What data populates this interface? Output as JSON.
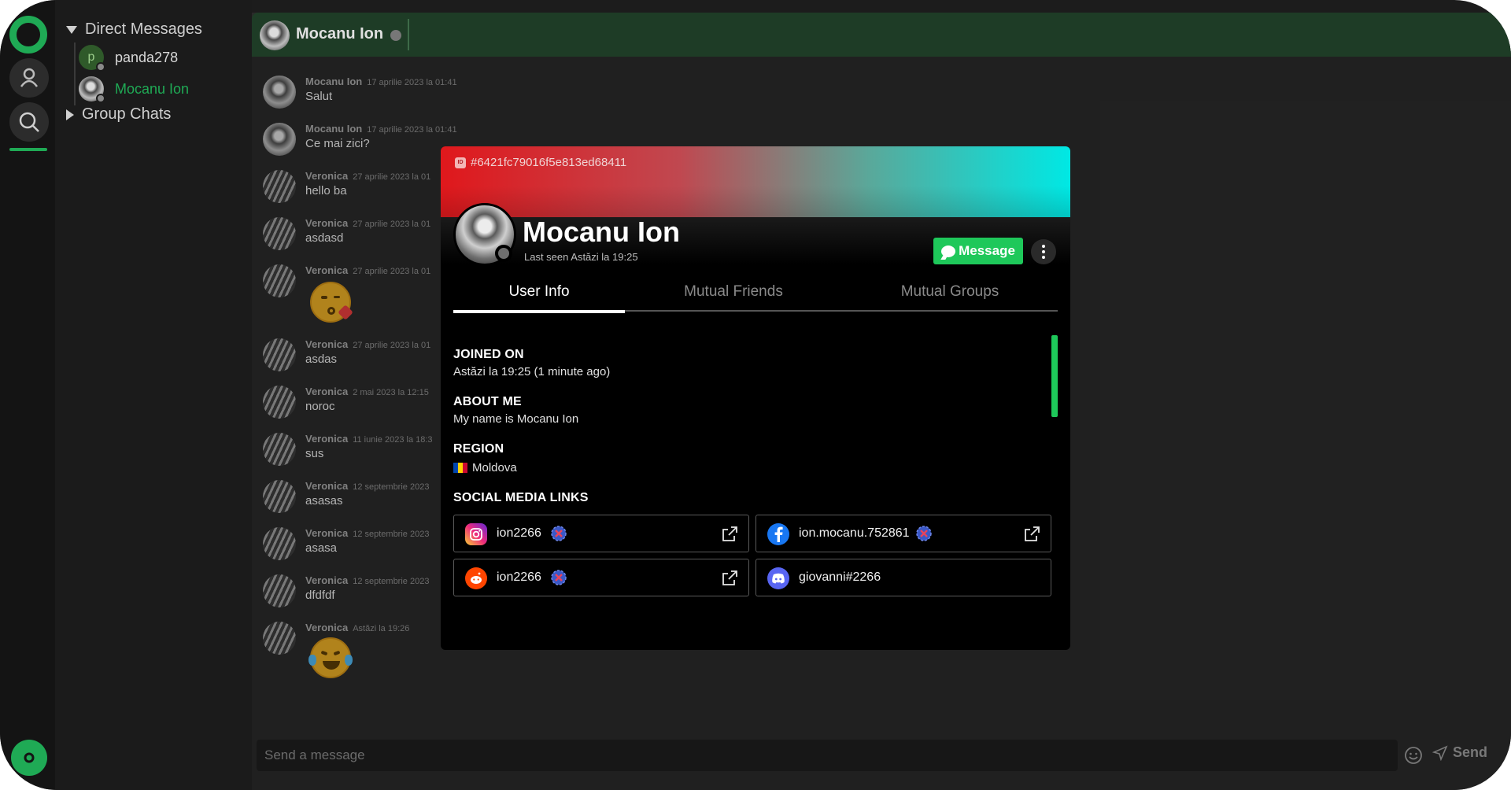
{
  "sidebar": {
    "direct_messages_label": "Direct Messages",
    "group_chats_label": "Group Chats",
    "dms": [
      {
        "name": "panda278",
        "initial": "p"
      },
      {
        "name": "Mocanu Ion"
      }
    ]
  },
  "chat": {
    "header_name": "Mocanu Ion",
    "messages": [
      {
        "author": "Mocanu Ion",
        "time": "17 aprilie 2023 la 01:41",
        "text": "Salut"
      },
      {
        "author": "Mocanu Ion",
        "time": "17 aprilie 2023 la 01:41",
        "text": "Ce mai zici?"
      },
      {
        "author": "Veronica",
        "time": "27 aprilie 2023 la 01",
        "text": "hello ba"
      },
      {
        "author": "Veronica",
        "time": "27 aprilie 2023 la 01",
        "text": "asdasd"
      },
      {
        "author": "Veronica",
        "time": "27 aprilie 2023 la 01",
        "text": ""
      },
      {
        "author": "Veronica",
        "time": "27 aprilie 2023 la 01",
        "text": "asdas"
      },
      {
        "author": "Veronica",
        "time": "2 mai 2023 la 12:15",
        "text": "noroc"
      },
      {
        "author": "Veronica",
        "time": "11 iunie 2023 la 18:3",
        "text": "sus"
      },
      {
        "author": "Veronica",
        "time": "12 septembrie 2023",
        "text": "asasas"
      },
      {
        "author": "Veronica",
        "time": "12 septembrie 2023",
        "text": "asasa"
      },
      {
        "author": "Veronica",
        "time": "12 septembrie 2023",
        "text": "dfdfdf"
      },
      {
        "author": "Veronica",
        "time": "Astăzi la 19:26",
        "text": ""
      }
    ],
    "composer_placeholder": "Send a message",
    "send_label": "Send"
  },
  "profile": {
    "id": "#6421fc79016f5e813ed68411",
    "id_icon_text": "ID",
    "name": "Mocanu Ion",
    "last_seen": "Last seen Astăzi la 19:25",
    "message_button": "Message",
    "tabs": [
      "User Info",
      "Mutual Friends",
      "Mutual Groups"
    ],
    "joined_label": "JOINED ON",
    "joined_value": "Astăzi la 19:25  (1 minute ago)",
    "about_label": "ABOUT ME",
    "about_value": "My name is Mocanu Ion",
    "region_label": "REGION",
    "region_value": "Moldova",
    "social_label": "SOCIAL MEDIA LINKS",
    "socials": [
      {
        "platform": "instagram",
        "handle": "ion2266",
        "verified": false
      },
      {
        "platform": "facebook",
        "handle": "ion.mocanu.752861",
        "verified": false
      },
      {
        "platform": "reddit",
        "handle": "ion2266",
        "verified": false
      },
      {
        "platform": "discord",
        "handle": "giovanni#2266"
      }
    ]
  },
  "colors": {
    "accent": "#1faa55",
    "message_button": "#1ec85a",
    "banner_left": "#e0181c",
    "banner_right": "#00e8e4",
    "header_bg": "#1e3c26"
  }
}
